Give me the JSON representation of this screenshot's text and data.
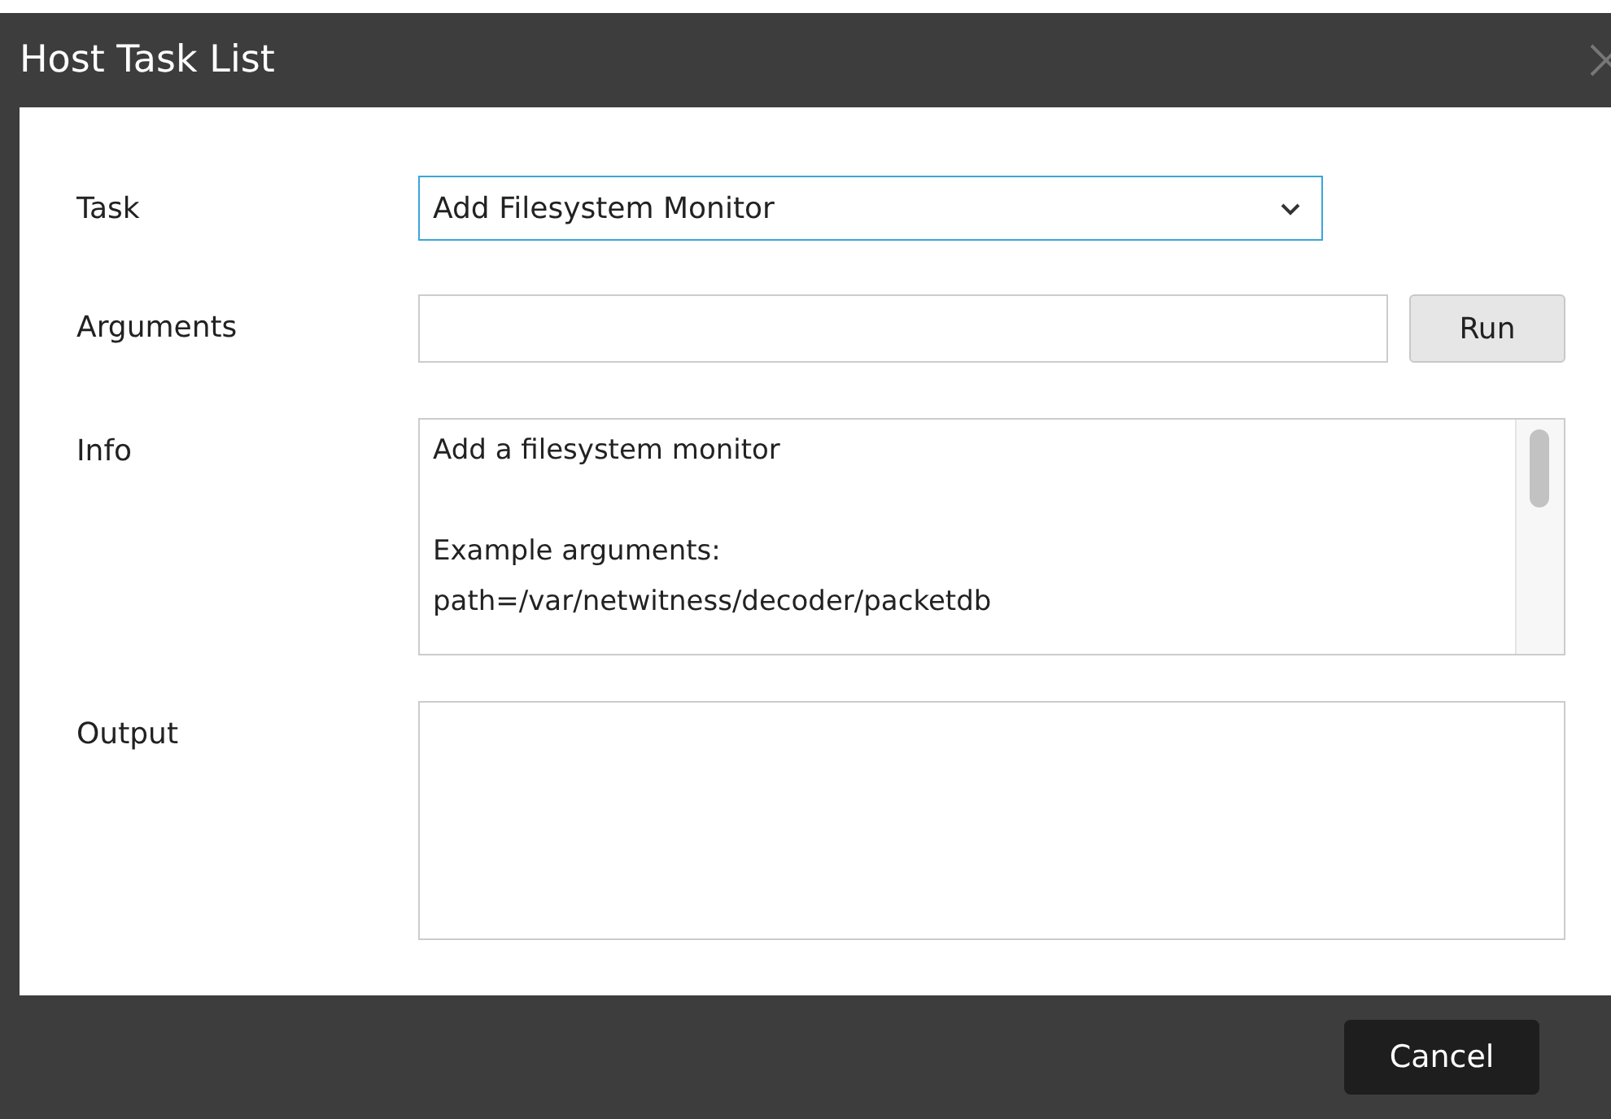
{
  "window": {
    "title": "Host Task List"
  },
  "form": {
    "task": {
      "label": "Task",
      "value": "Add Filesystem Monitor"
    },
    "arguments": {
      "label": "Arguments",
      "button": "Run"
    },
    "info": {
      "label": "Info",
      "text": "Add a filesystem monitor\n\nExample arguments:\npath=/var/netwitness/decoder/packetdb"
    },
    "output": {
      "label": "Output"
    }
  },
  "buttons": [
    "Cancel"
  ]
}
